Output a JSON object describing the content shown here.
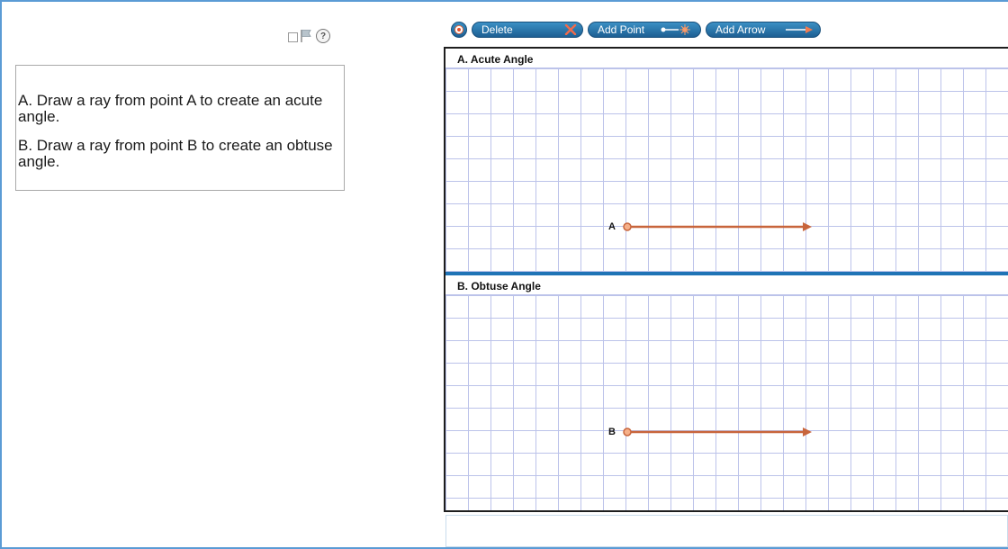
{
  "item_tools": {
    "mark_icon": "checkbox-icon",
    "flag_icon": "flag-icon",
    "help_icon": "help-icon",
    "help_glyph": "?"
  },
  "question": {
    "part_a": "A. Draw a ray from point A to create an acute angle.",
    "part_b": "B. Draw a ray from point B to create an obtuse angle."
  },
  "toolbar": {
    "reset_icon": "reset-icon",
    "delete_label": "Delete",
    "delete_icon": "x-icon",
    "add_point_label": "Add Point",
    "add_point_icon": "point-sparkle-icon",
    "add_arrow_label": "Add Arrow",
    "add_arrow_icon": "arrow-right-icon"
  },
  "panels": [
    {
      "title": "A. Acute Angle",
      "point_label": "A"
    },
    {
      "title": "B. Obtuse Angle",
      "point_label": "B"
    }
  ],
  "colors": {
    "frame_border": "#5b9bd5",
    "toolbar_button": "#1d5f93",
    "grid_line": "#bcc3ea",
    "ray": "#c8653c",
    "panel_separator": "#1f74b6"
  }
}
